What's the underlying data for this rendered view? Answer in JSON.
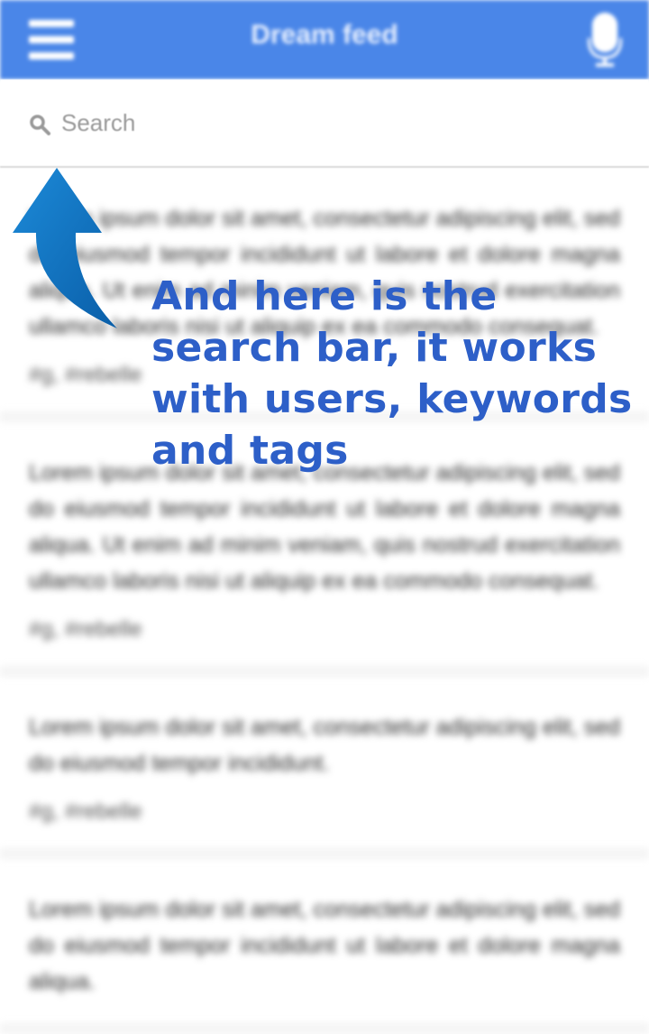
{
  "appbar": {
    "title": "Dream feed",
    "menu_icon": "hamburger-menu-icon",
    "mic_icon": "microphone-icon",
    "color": "#4a86e8"
  },
  "search": {
    "placeholder": "Search",
    "icon": "search-icon"
  },
  "feed": {
    "posts": [
      {
        "text": "Lorem ipsum dolor sit amet, consectetur adipiscing elit, sed do eiusmod tempor incididunt ut labore et dolore magna aliqua. Ut enim ad minim veniam, quis nostrud exercitation ullamco laboris nisi ut aliquip ex ea commodo consequat.",
        "tag": "#g, #rebelle"
      },
      {
        "text": "Lorem ipsum dolor sit amet, consectetur adipiscing elit, sed do eiusmod tempor incididunt ut labore et dolore magna aliqua. Ut enim ad minim veniam, quis nostrud exercitation ullamco laboris nisi ut aliquip ex ea commodo consequat.",
        "tag": "#g, #rebelle"
      },
      {
        "text": "Lorem ipsum dolor sit amet, consectetur adipiscing elit, sed do eiusmod tempor incididunt.",
        "tag": "#g, #rebelle"
      },
      {
        "text": "Lorem ipsum dolor sit amet, consectetur adipiscing elit, sed do eiusmod tempor incididunt ut labore et dolore magna aliqua.",
        "tag": ""
      }
    ]
  },
  "annotation": {
    "text": "And here is the search bar, it works with users, keywords and tags",
    "color": "#2d5fc8",
    "arrow_color": "#0a72c0"
  }
}
